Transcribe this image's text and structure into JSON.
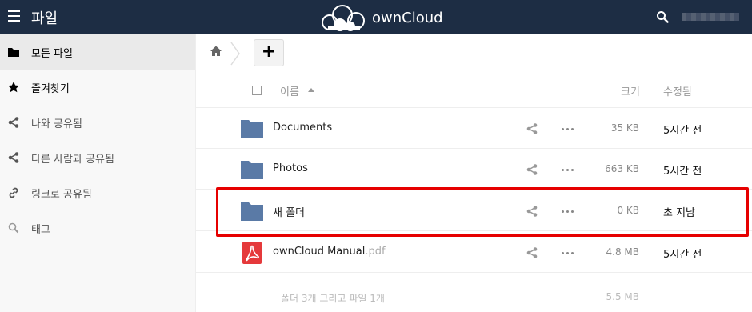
{
  "header": {
    "app_title": "파일",
    "brand": "ownCloud",
    "menu_icon": "hamburger-icon",
    "search_icon": "search-icon",
    "colors": {
      "header_bg": "#1d2d44",
      "folder": "#5a7aa6",
      "pdf": "#e5393b",
      "highlight": "#e60000"
    }
  },
  "sidebar": {
    "items": [
      {
        "label": "모든 파일",
        "icon": "folder-icon"
      },
      {
        "label": "즐겨찾기",
        "icon": "star-icon"
      },
      {
        "label": "나와 공유됨",
        "icon": "share-icon"
      },
      {
        "label": "다른 사람과 공유됨",
        "icon": "share-icon"
      },
      {
        "label": "링크로 공유됨",
        "icon": "link-icon"
      },
      {
        "label": "태그",
        "icon": "tag-search-icon"
      }
    ]
  },
  "controls": {
    "add_label": "+",
    "home_icon": "home-icon"
  },
  "table": {
    "columns": {
      "name": "이름",
      "size": "크기",
      "modified": "수정됨"
    },
    "rows": [
      {
        "name": "Documents",
        "ext": "",
        "type": "folder",
        "size": "35 KB",
        "modified": "5시간 전"
      },
      {
        "name": "Photos",
        "ext": "",
        "type": "folder",
        "size": "663 KB",
        "modified": "5시간 전"
      },
      {
        "name": "새 폴더",
        "ext": "",
        "type": "folder",
        "size": "0 KB",
        "modified": "초 지남"
      },
      {
        "name": "ownCloud Manual",
        "ext": ".pdf",
        "type": "pdf",
        "size": "4.8 MB",
        "modified": "5시간 전"
      }
    ],
    "summary": {
      "text": "폴더 3개 그리고 파일 1개",
      "size": "5.5 MB"
    }
  }
}
